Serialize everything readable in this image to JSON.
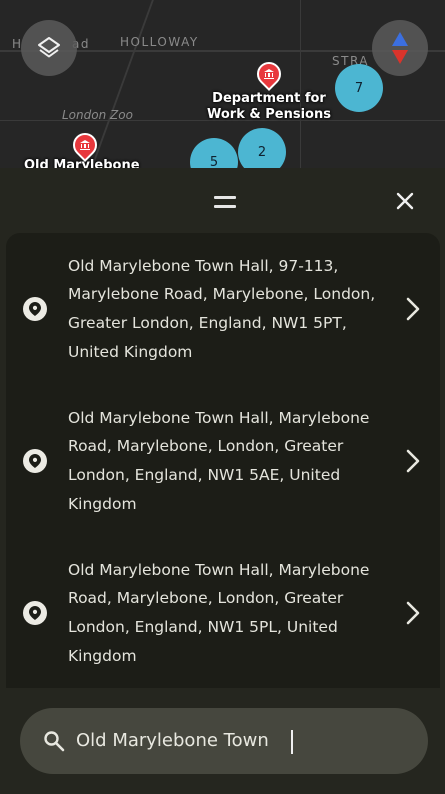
{
  "map": {
    "labels": {
      "holloway": "HOLLOWAY",
      "road_fragment": "H",
      "road_fragment2": "ad",
      "strand": "STRA",
      "zoo": "London Zoo",
      "old_mary": "Old Marylebone"
    },
    "poi": {
      "line1": "Department for",
      "line2": "Work & Pensions"
    },
    "clusters": [
      "7",
      "5",
      "2"
    ]
  },
  "results": [
    {
      "lines": [
        "Old Marylebone Town Hall, 97-113,",
        "Marylebone Road, Marylebone, London,",
        "Greater London, England, NW1 5PT,",
        "United Kingdom"
      ]
    },
    {
      "lines": [
        "Old Marylebone Town Hall, Marylebone",
        "Road, Marylebone, London, Greater",
        "London, England, NW1 5AE, United",
        "Kingdom"
      ]
    },
    {
      "lines": [
        "Old Marylebone Town Hall, Marylebone",
        "Road, Marylebone, London, Greater",
        "London, England, NW1 5PL, United",
        "Kingdom"
      ]
    }
  ],
  "search": {
    "value": "Old Marylebone Town"
  },
  "icons": {
    "layers": "layers-icon",
    "compass": "compass-icon",
    "close": "close-icon",
    "drag": "drag-handle-icon",
    "pin": "location-pin-icon",
    "chevron": "chevron-right-icon",
    "search": "search-icon"
  },
  "colors": {
    "cluster": "#4cb6d2",
    "poi_pin": "#e8383d",
    "compass_north": "#3b6fe0",
    "compass_south": "#d9342b",
    "sheet": "#25261f",
    "results_bg": "#1c1d17",
    "search_box": "#46473e"
  }
}
